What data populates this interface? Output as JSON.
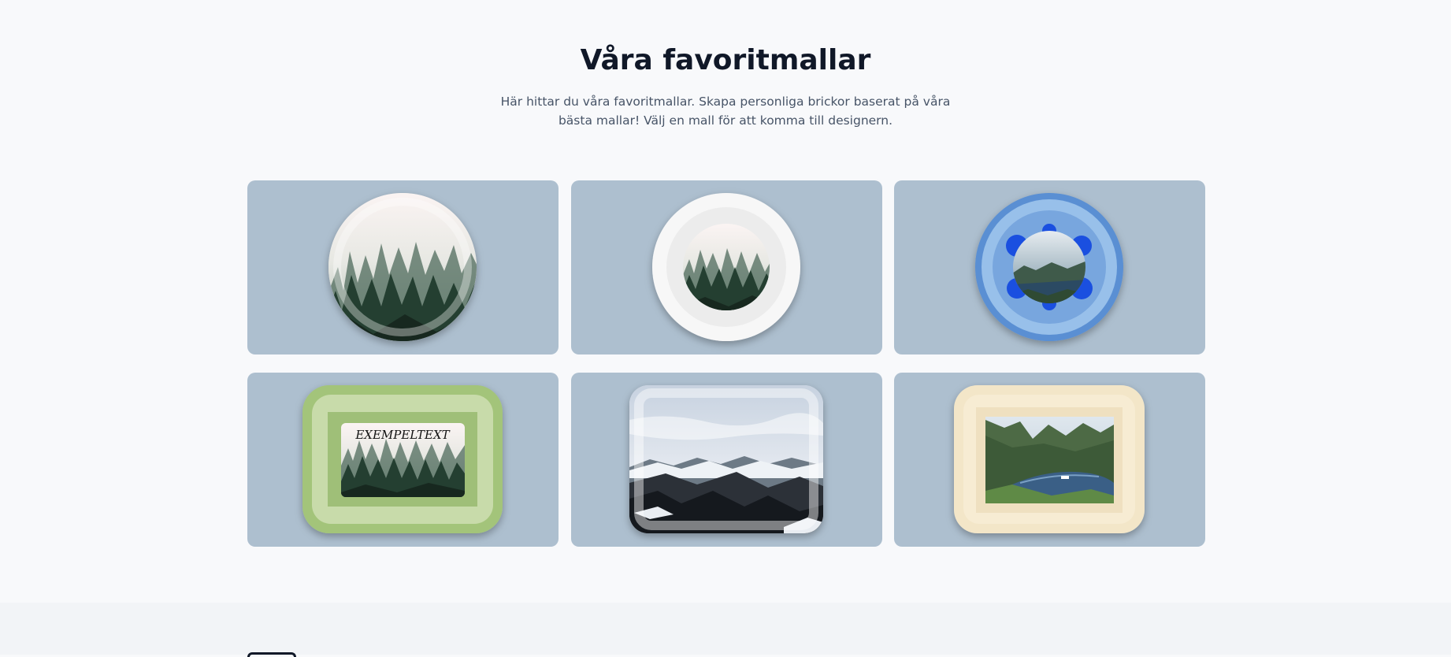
{
  "section": {
    "title": "Våra favoritmallar",
    "subtitle": "Här hittar du våra favoritmallar. Skapa personliga brickor baserat på våra bästa mallar! Välj en mall för att komma till designern."
  },
  "templates": [
    {
      "shape": "round",
      "motif": "misty-forest",
      "frame": "translucent white ring"
    },
    {
      "shape": "round",
      "motif": "misty-forest",
      "frame": "light grey border"
    },
    {
      "shape": "round",
      "motif": "fjord-landscape",
      "frame": "blue rings with blue flower shape"
    },
    {
      "shape": "rectangular",
      "motif": "misty-forest",
      "frame": "green border",
      "text": "EXEMPELTEXT"
    },
    {
      "shape": "rectangular",
      "motif": "snowy-mountains",
      "frame": "translucent white border"
    },
    {
      "shape": "rectangular",
      "motif": "fjord-landscape",
      "frame": "cream wood border"
    }
  ],
  "colors": {
    "card_background": "#adbfcf",
    "page_background": "#f8f9fb",
    "footer_background": "#f2f4f7"
  }
}
